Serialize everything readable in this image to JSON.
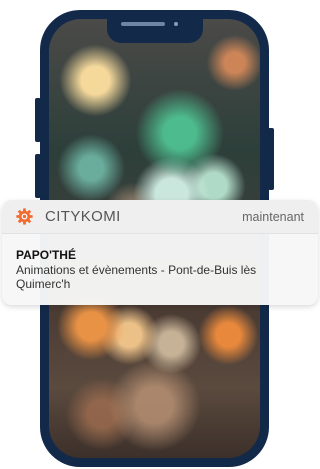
{
  "notification": {
    "app_name": "CITYKOMI",
    "app_icon": "citykomi-gear-logo-icon",
    "time": "maintenant",
    "title": "PAPO'THÉ",
    "message": "Animations et évènements - Pont-de-Buis lès Quimerc'h"
  },
  "colors": {
    "phone_frame": "#13294a",
    "brand_orange": "#f26a2e",
    "notification_bg": "#f7f7f7"
  }
}
